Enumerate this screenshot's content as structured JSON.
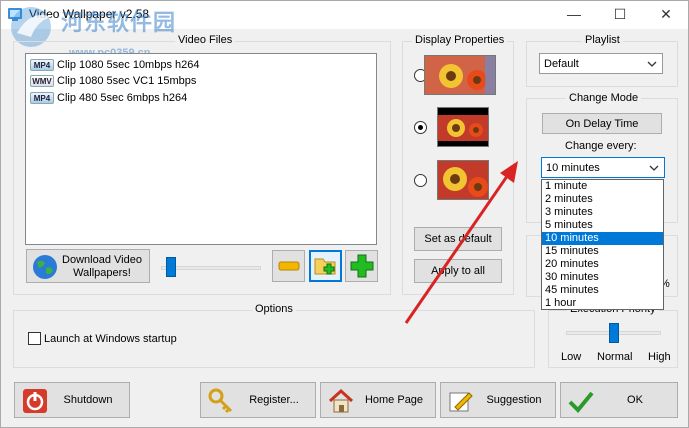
{
  "window": {
    "title": "Video Wallpaper  v2.58",
    "minimize": "—",
    "maximize": "☐",
    "close": "✕"
  },
  "watermark": {
    "text": "河东软件园",
    "url": "www.pc0359.cn"
  },
  "video_files": {
    "title": "Video Files",
    "items": [
      {
        "format": "MP4",
        "name": "Clip 1080 5sec 10mbps h264"
      },
      {
        "format": "WMV",
        "name": "Clip 1080 5sec VC1 15mbps"
      },
      {
        "format": "MP4",
        "name": "Clip 480 5sec 6mbps h264"
      }
    ],
    "download_button": "Download Video Wallpapers!"
  },
  "display_properties": {
    "title": "Display Properties",
    "selected_index": 1,
    "set_default": "Set as default",
    "apply_all": "Apply to all"
  },
  "playlist": {
    "title": "Playlist",
    "value": "Default"
  },
  "change_mode": {
    "title": "Change Mode",
    "mode_button": "On Delay Time",
    "change_every_label": "Change every:",
    "value": "10 minutes",
    "options": [
      "1 minute",
      "2 minutes",
      "3 minutes",
      "5 minutes",
      "10 minutes",
      "15 minutes",
      "20 minutes",
      "30 minutes",
      "45 minutes",
      "1 hour"
    ],
    "selected_index": 4
  },
  "partial_percent": "%",
  "options": {
    "title": "Options",
    "launch_label": "Launch at Windows startup",
    "launch_checked": false
  },
  "execution_priority": {
    "title": "Execution Priority",
    "low": "Low",
    "normal": "Normal",
    "high": "High",
    "level": 0.5
  },
  "volume_level": 0.1,
  "bottom": {
    "shutdown": "Shutdown",
    "register": "Register...",
    "home_page": "Home Page",
    "suggestion": "Suggestion",
    "ok": "OK"
  },
  "colors": {
    "accent": "#0078d7",
    "arrow": "#e02020",
    "plus": "#22bb22",
    "minus": "#f2b600"
  }
}
